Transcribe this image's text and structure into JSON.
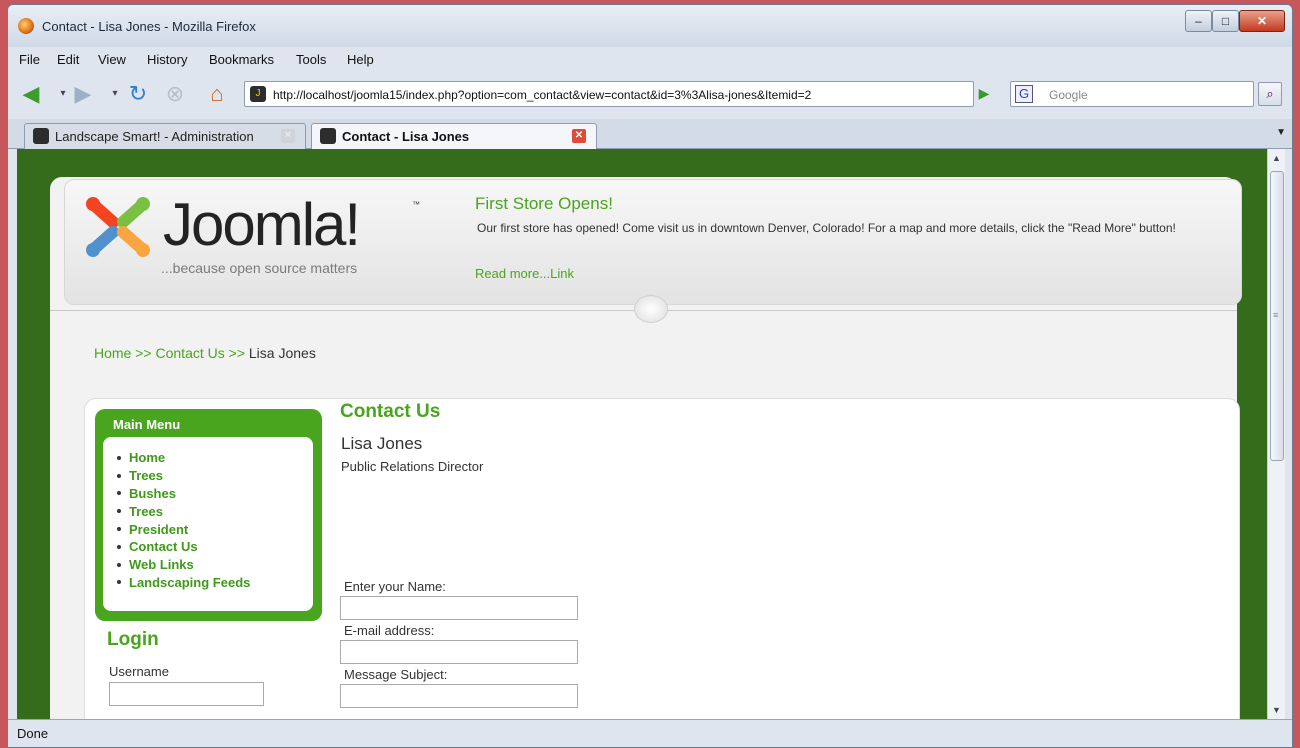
{
  "window": {
    "title": "Contact - Lisa Jones - Mozilla Firefox",
    "min_glyph": "–",
    "max_glyph": "□",
    "close_glyph": "✕"
  },
  "menubar": [
    "File",
    "Edit",
    "View",
    "History",
    "Bookmarks",
    "Tools",
    "Help"
  ],
  "nav": {
    "url": "http://localhost/joomla15/index.php?option=com_contact&view=contact&id=3%3Alisa-jones&Itemid=2",
    "search_placeholder": "Google"
  },
  "tabs": [
    {
      "label": "Landscape Smart! - Administration"
    },
    {
      "label": "Contact - Lisa Jones"
    }
  ],
  "page": {
    "logo": {
      "text": "Joomla!",
      "tagline": "...because open source matters"
    },
    "news": {
      "title": "First Store Opens!",
      "body": "Our first store has opened! Come visit us in downtown Denver, Colorado! For a map and more details, click the \"Read More\" button!",
      "link": "Read more...Link"
    },
    "breadcrumb": {
      "home": "Home",
      "sep1": ">>",
      "contact_us": "Contact Us",
      "sep2": ">>",
      "current": "Lisa Jones"
    },
    "main_menu": {
      "title": "Main Menu",
      "items": [
        "Home",
        "Trees",
        "Bushes",
        "Trees",
        "President",
        "Contact Us",
        "Web Links",
        "Landscaping Feeds"
      ]
    },
    "login": {
      "title": "Login",
      "username_label": "Username"
    },
    "contact": {
      "heading": "Contact Us",
      "name": "Lisa Jones",
      "position": "Public Relations Director",
      "form": {
        "name_label": "Enter your Name:",
        "email_label": "E-mail address:",
        "subject_label": "Message Subject:"
      }
    }
  },
  "status": {
    "text": "Done"
  },
  "colors": {
    "accent": "#4aa51e",
    "background_green": "#346c1b",
    "close_red": "#e04a3a"
  }
}
